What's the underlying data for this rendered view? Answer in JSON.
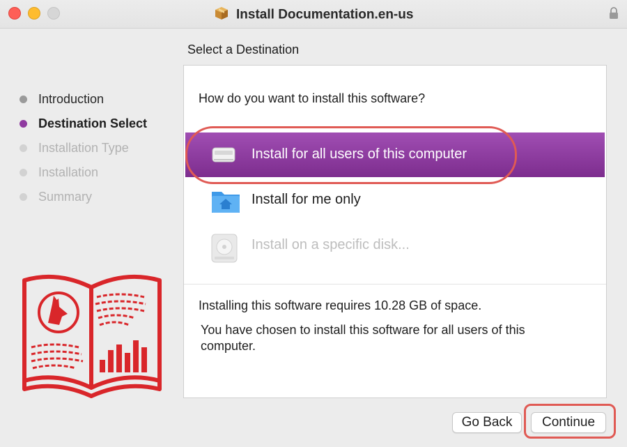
{
  "window": {
    "title": "Install Documentation.en-us",
    "title_icon": "package-icon",
    "lock_icon": "lock-icon"
  },
  "pane_title": "Select a Destination",
  "steps": [
    {
      "label": "Introduction",
      "state": "done"
    },
    {
      "label": "Destination Select",
      "state": "current"
    },
    {
      "label": "Installation Type",
      "state": "future"
    },
    {
      "label": "Installation",
      "state": "future"
    },
    {
      "label": "Summary",
      "state": "future"
    }
  ],
  "question": "How do you want to install this software?",
  "options": [
    {
      "label": "Install for all users of this computer",
      "icon": "computer-icon",
      "selected": true,
      "enabled": true
    },
    {
      "label": "Install for me only",
      "icon": "home-folder-icon",
      "selected": false,
      "enabled": true
    },
    {
      "label": "Install on a specific disk...",
      "icon": "disk-icon",
      "selected": false,
      "enabled": false
    }
  ],
  "space_requirement": "Installing this software requires 10.28 GB of space.",
  "choice_description": "You have chosen to install this software for all users of this computer.",
  "buttons": {
    "go_back": "Go Back",
    "continue": "Continue"
  },
  "colors": {
    "accent": "#8f3aa0",
    "highlight_ring": "#e05a54",
    "logo_red": "#d9262a"
  }
}
